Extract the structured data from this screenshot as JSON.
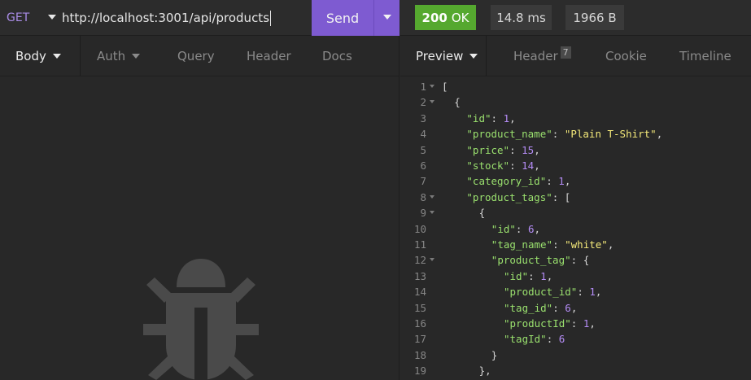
{
  "request": {
    "method": "GET",
    "url": "http://localhost:3001/api/products",
    "send_label": "Send",
    "tabs": [
      {
        "label": "Body",
        "active": true,
        "has_caret": true
      },
      {
        "label": "Auth",
        "active": false,
        "has_caret": true
      },
      {
        "label": "Query",
        "active": false,
        "has_caret": false
      },
      {
        "label": "Header",
        "active": false,
        "has_caret": false
      },
      {
        "label": "Docs",
        "active": false,
        "has_caret": false
      }
    ],
    "empty_state_icon": "bug-icon"
  },
  "response": {
    "status_code": "200",
    "status_text": "OK",
    "time": "14.8 ms",
    "size": "1966 B",
    "tabs": [
      {
        "label": "Preview",
        "active": true,
        "has_caret": true
      },
      {
        "label": "Header",
        "active": false,
        "badge": "7"
      },
      {
        "label": "Cookie",
        "active": false
      },
      {
        "label": "Timeline",
        "active": false
      }
    ],
    "lines": [
      {
        "num": "1",
        "fold": true,
        "indent": 0,
        "tokens": [
          [
            "p",
            "["
          ]
        ]
      },
      {
        "num": "2",
        "fold": true,
        "indent": 1,
        "tokens": [
          [
            "p",
            "{"
          ]
        ]
      },
      {
        "num": "3",
        "fold": false,
        "indent": 2,
        "tokens": [
          [
            "k",
            "\"id\""
          ],
          [
            "p",
            ": "
          ],
          [
            "n",
            "1"
          ],
          [
            "p",
            ","
          ]
        ]
      },
      {
        "num": "4",
        "fold": false,
        "indent": 2,
        "tokens": [
          [
            "k",
            "\"product_name\""
          ],
          [
            "p",
            ": "
          ],
          [
            "s",
            "\"Plain T-Shirt\""
          ],
          [
            "p",
            ","
          ]
        ]
      },
      {
        "num": "5",
        "fold": false,
        "indent": 2,
        "tokens": [
          [
            "k",
            "\"price\""
          ],
          [
            "p",
            ": "
          ],
          [
            "n",
            "15"
          ],
          [
            "p",
            ","
          ]
        ]
      },
      {
        "num": "6",
        "fold": false,
        "indent": 2,
        "tokens": [
          [
            "k",
            "\"stock\""
          ],
          [
            "p",
            ": "
          ],
          [
            "n",
            "14"
          ],
          [
            "p",
            ","
          ]
        ]
      },
      {
        "num": "7",
        "fold": false,
        "indent": 2,
        "tokens": [
          [
            "k",
            "\"category_id\""
          ],
          [
            "p",
            ": "
          ],
          [
            "n",
            "1"
          ],
          [
            "p",
            ","
          ]
        ]
      },
      {
        "num": "8",
        "fold": true,
        "indent": 2,
        "tokens": [
          [
            "k",
            "\"product_tags\""
          ],
          [
            "p",
            ": ["
          ]
        ]
      },
      {
        "num": "9",
        "fold": true,
        "indent": 3,
        "tokens": [
          [
            "p",
            "{"
          ]
        ]
      },
      {
        "num": "10",
        "fold": false,
        "indent": 4,
        "tokens": [
          [
            "k",
            "\"id\""
          ],
          [
            "p",
            ": "
          ],
          [
            "n",
            "6"
          ],
          [
            "p",
            ","
          ]
        ]
      },
      {
        "num": "11",
        "fold": false,
        "indent": 4,
        "tokens": [
          [
            "k",
            "\"tag_name\""
          ],
          [
            "p",
            ": "
          ],
          [
            "s",
            "\"white\""
          ],
          [
            "p",
            ","
          ]
        ]
      },
      {
        "num": "12",
        "fold": true,
        "indent": 4,
        "tokens": [
          [
            "k",
            "\"product_tag\""
          ],
          [
            "p",
            ": {"
          ]
        ]
      },
      {
        "num": "13",
        "fold": false,
        "indent": 5,
        "tokens": [
          [
            "k",
            "\"id\""
          ],
          [
            "p",
            ": "
          ],
          [
            "n",
            "1"
          ],
          [
            "p",
            ","
          ]
        ]
      },
      {
        "num": "14",
        "fold": false,
        "indent": 5,
        "tokens": [
          [
            "k",
            "\"product_id\""
          ],
          [
            "p",
            ": "
          ],
          [
            "n",
            "1"
          ],
          [
            "p",
            ","
          ]
        ]
      },
      {
        "num": "15",
        "fold": false,
        "indent": 5,
        "tokens": [
          [
            "k",
            "\"tag_id\""
          ],
          [
            "p",
            ": "
          ],
          [
            "n",
            "6"
          ],
          [
            "p",
            ","
          ]
        ]
      },
      {
        "num": "16",
        "fold": false,
        "indent": 5,
        "tokens": [
          [
            "k",
            "\"productId\""
          ],
          [
            "p",
            ": "
          ],
          [
            "n",
            "1"
          ],
          [
            "p",
            ","
          ]
        ]
      },
      {
        "num": "17",
        "fold": false,
        "indent": 5,
        "tokens": [
          [
            "k",
            "\"tagId\""
          ],
          [
            "p",
            ": "
          ],
          [
            "n",
            "6"
          ]
        ]
      },
      {
        "num": "18",
        "fold": false,
        "indent": 4,
        "tokens": [
          [
            "p",
            "}"
          ]
        ]
      },
      {
        "num": "19",
        "fold": false,
        "indent": 3,
        "tokens": [
          [
            "p",
            "},"
          ]
        ]
      }
    ]
  },
  "colors": {
    "accent": "#7e5bd1",
    "status_ok": "#55a82f",
    "json_key": "#9ae06e",
    "json_string": "#f5ea7a",
    "json_number": "#b48cf5"
  }
}
